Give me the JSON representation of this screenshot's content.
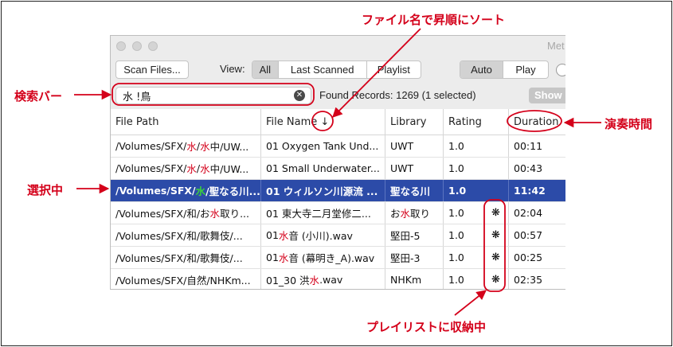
{
  "window": {
    "title": "Met"
  },
  "toolbar": {
    "scan_label": "Scan Files...",
    "view_label": "View:",
    "view_tabs": [
      {
        "label": "All",
        "selected": true
      },
      {
        "label": "Last Scanned",
        "selected": false
      },
      {
        "label": "Playlist",
        "selected": false
      }
    ],
    "mode_tabs": [
      {
        "label": "Auto",
        "selected": true
      },
      {
        "label": "Play",
        "selected": false
      }
    ]
  },
  "search": {
    "value": "水 !鳥"
  },
  "status": {
    "found": "Found Records: 1269 (1 selected)",
    "show_label": "Show"
  },
  "table": {
    "columns": [
      "File Path",
      "File Name ↓",
      "Library",
      "Rating",
      "Duration"
    ],
    "rows": [
      {
        "path_a": "/Volumes/SFX/",
        "path_hl1": "水",
        "path_b": "/",
        "path_hl2": "水",
        "path_c": "中/UW...",
        "name_a": "01 Oxygen Tank Und...",
        "name_hl": "",
        "name_b": "",
        "lib_a": "UWT",
        "lib_hl": "",
        "lib_b": "",
        "rating": "1.0",
        "playlist": "",
        "duration": "00:11"
      },
      {
        "path_a": "/Volumes/SFX/",
        "path_hl1": "水",
        "path_b": "/",
        "path_hl2": "水",
        "path_c": "中/UW...",
        "name_a": "01 Small Underwater...",
        "name_hl": "",
        "name_b": "",
        "lib_a": "UWT",
        "lib_hl": "",
        "lib_b": "",
        "rating": "1.0",
        "playlist": "",
        "duration": "00:43"
      },
      {
        "path_a": "/Volumes/SFX/",
        "path_hl1": "水",
        "path_b": "/聖なる川...",
        "path_hl2": "",
        "path_c": "",
        "name_a": "01 ウィルソン川源流 ...",
        "name_hl": "",
        "name_b": "",
        "lib_a": "聖なる川",
        "lib_hl": "",
        "lib_b": "",
        "rating": "1.0",
        "playlist": "",
        "duration": "11:42"
      },
      {
        "path_a": "/Volumes/SFX/和/お",
        "path_hl1": "水",
        "path_b": "取り...",
        "path_hl2": "",
        "path_c": "",
        "name_a": "01 東大寺二月堂修二...",
        "name_hl": "",
        "name_b": "",
        "lib_a": "お",
        "lib_hl": "水",
        "lib_b": "取り",
        "rating": "1.0",
        "playlist": "❋",
        "duration": "02:04"
      },
      {
        "path_a": "/Volumes/SFX/和/歌舞伎/...",
        "path_hl1": "",
        "path_b": "",
        "path_hl2": "",
        "path_c": "",
        "name_a": "01 ",
        "name_hl": "水",
        "name_b": "音 (小川).wav",
        "lib_a": "堅田-5",
        "lib_hl": "",
        "lib_b": "",
        "rating": "1.0",
        "playlist": "❋",
        "duration": "00:57"
      },
      {
        "path_a": "/Volumes/SFX/和/歌舞伎/...",
        "path_hl1": "",
        "path_b": "",
        "path_hl2": "",
        "path_c": "",
        "name_a": "01 ",
        "name_hl": "水",
        "name_b": "音 (幕明き_A).wav",
        "lib_a": "堅田-3",
        "lib_hl": "",
        "lib_b": "",
        "rating": "1.0",
        "playlist": "❋",
        "duration": "00:25"
      },
      {
        "path_a": "/Volumes/SFX/自然/NHKm...",
        "path_hl1": "",
        "path_b": "",
        "path_hl2": "",
        "path_c": "",
        "name_a": "01_30 洪",
        "name_hl": "水",
        "name_b": ".wav",
        "lib_a": "NHKm",
        "lib_hl": "",
        "lib_b": "",
        "rating": "1.0",
        "playlist": "❋",
        "duration": "02:35"
      }
    ]
  },
  "annotations": {
    "sort": "ファイル名で昇順にソート",
    "search": "検索バー",
    "duration": "演奏時間",
    "selected": "選択中",
    "playlist": "プレイリストに収納中"
  },
  "colors": {
    "annotation": "#d4001a",
    "selection": "#2c4ba8",
    "match_highlight": "#d4001a",
    "selected_match": "#3bd13b"
  }
}
